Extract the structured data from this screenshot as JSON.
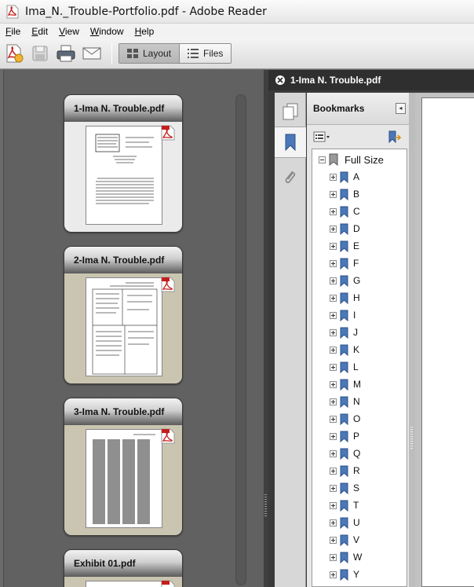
{
  "window": {
    "title": "Ima_N._Trouble-Portfolio.pdf - Adobe Reader"
  },
  "menu": [
    {
      "u": "F",
      "rest": "ile"
    },
    {
      "u": "E",
      "rest": "dit"
    },
    {
      "u": "V",
      "rest": "iew"
    },
    {
      "u": "W",
      "rest": "indow"
    },
    {
      "u": "H",
      "rest": "elp"
    }
  ],
  "toolbar": {
    "icons": [
      "create-pdf-icon",
      "save-icon",
      "print-icon",
      "email-icon"
    ],
    "layout_label": "Layout",
    "files_label": "Files"
  },
  "portfolio": {
    "cards": [
      {
        "name": "1-Ima N. Trouble.pdf",
        "selected": true
      },
      {
        "name": "2-Ima N. Trouble.pdf",
        "selected": false
      },
      {
        "name": "3-Ima N. Trouble.pdf",
        "selected": false
      },
      {
        "name": "Exhibit 01.pdf",
        "selected": false
      }
    ]
  },
  "document": {
    "tab_title": "1-Ima N. Trouble.pdf",
    "bookmarks_label": "Bookmarks",
    "root": "Full Size",
    "bookmarks": [
      "A",
      "B",
      "C",
      "D",
      "E",
      "F",
      "G",
      "H",
      "I",
      "J",
      "K",
      "L",
      "M",
      "N",
      "O",
      "P",
      "Q",
      "R",
      "S",
      "T",
      "U",
      "V",
      "W",
      "Y"
    ]
  },
  "colors": {
    "pdf_red": "#c41e1e",
    "bookmark_blue": "#4a78b8"
  }
}
